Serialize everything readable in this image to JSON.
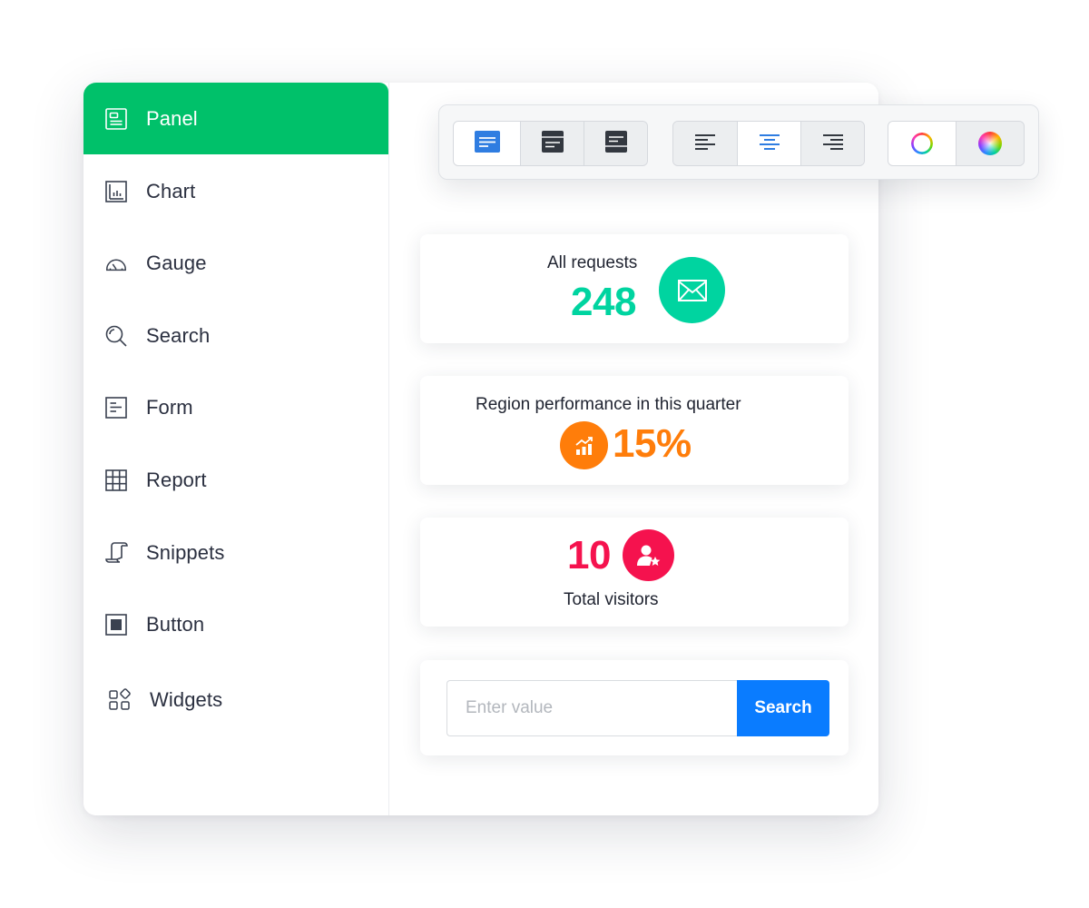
{
  "sidebar": {
    "items": [
      {
        "label": "Panel",
        "icon": "panel-icon",
        "active": true
      },
      {
        "label": "Chart",
        "icon": "chart-icon"
      },
      {
        "label": "Gauge",
        "icon": "gauge-icon"
      },
      {
        "label": "Search",
        "icon": "search-icon"
      },
      {
        "label": "Form",
        "icon": "form-icon"
      },
      {
        "label": "Report",
        "icon": "table-icon"
      },
      {
        "label": "Snippets",
        "icon": "scroll-icon"
      },
      {
        "label": "Button",
        "icon": "button-icon"
      },
      {
        "label": "Widgets",
        "icon": "widgets-icon"
      }
    ]
  },
  "toolbar": {
    "layout_buttons": [
      "layout-text-icon",
      "layout-header-icon",
      "layout-dark-icon"
    ],
    "align_buttons": [
      "align-left-icon",
      "align-center-icon",
      "align-right-icon"
    ],
    "color_buttons": [
      "color-ring-icon",
      "color-wheel-icon"
    ],
    "active_layout": "layout-text-icon",
    "active_align": "align-center-icon"
  },
  "cards": {
    "requests": {
      "label": "All requests",
      "value": "248",
      "icon": "envelope-icon",
      "color": "#00d4a0"
    },
    "region": {
      "label": "Region performance in this quarter",
      "value": "15%",
      "icon": "trend-chart-icon",
      "color": "#ff7d0a"
    },
    "visitors": {
      "label": "Total visitors",
      "value": "10",
      "icon": "user-star-icon",
      "color": "#f5124e"
    }
  },
  "search": {
    "placeholder": "Enter value",
    "button_label": "Search"
  },
  "colors": {
    "accent_green": "#00c16a",
    "accent_blue": "#0a7cff",
    "active_icon_blue": "#2f7de1"
  }
}
